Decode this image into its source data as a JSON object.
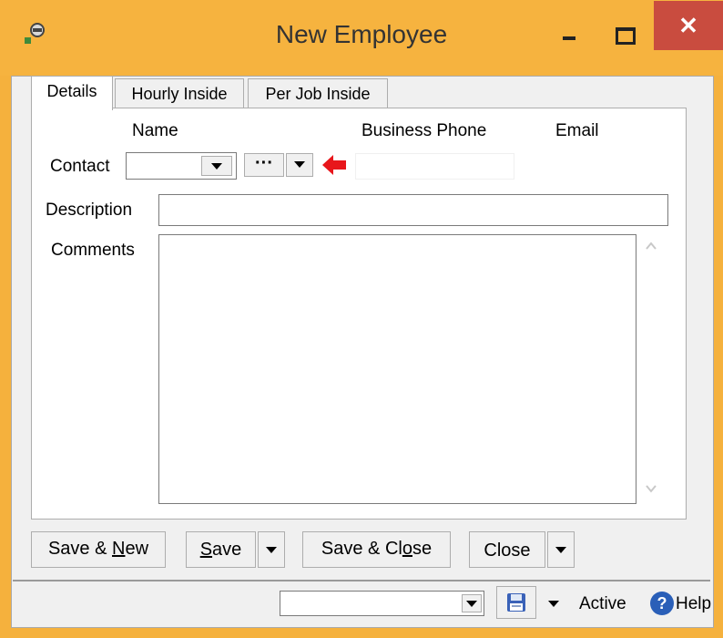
{
  "window": {
    "title": "New Employee",
    "close_glyph": "✕"
  },
  "tabs": [
    {
      "label": "Details",
      "active": true
    },
    {
      "label": "Hourly Inside",
      "active": false
    },
    {
      "label": "Per Job Inside",
      "active": false
    }
  ],
  "details": {
    "name_header": "Name",
    "business_phone_header": "Business Phone",
    "email_header": "Email",
    "contact_label": "Contact",
    "contact_value": "",
    "lookup_glyph": "···",
    "business_phone_value": "",
    "description_label": "Description",
    "description_value": "",
    "comments_label": "Comments",
    "comments_value": ""
  },
  "buttons": {
    "save_new": {
      "pre": "Save & ",
      "u": "N",
      "post": "ew"
    },
    "save": {
      "pre": "",
      "u": "S",
      "post": "ave"
    },
    "save_close": {
      "pre": "Save & Cl",
      "u": "o",
      "post": "se"
    },
    "close": "Close"
  },
  "status": {
    "combo_value": "",
    "active_label": "Active",
    "help_label": "Help"
  },
  "colors": {
    "title_bar": "#f6b33f",
    "close_button": "#c94c3f",
    "arrow_indicator": "#e8161b",
    "help_icon": "#2a5fb8"
  }
}
